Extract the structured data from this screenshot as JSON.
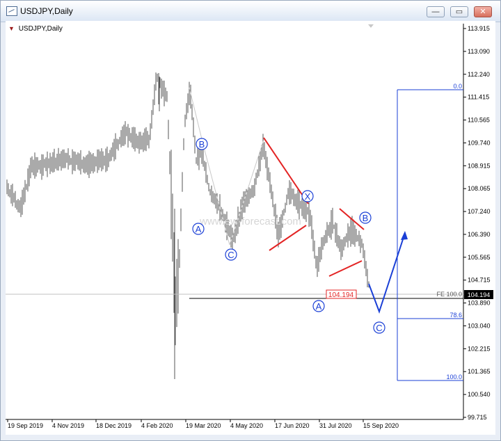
{
  "window": {
    "title": "USDJPY,Daily",
    "buttons": {
      "minimize": "—",
      "restore": "▭",
      "close": "✕"
    }
  },
  "chart": {
    "symbol_label": "USDJPY,Daily",
    "current_price": "104.194",
    "price_box_label": "104.194",
    "watermark": "www.ew-forecast.com",
    "fib_labels": [
      "0.0",
      "FE 100.0",
      "78.6",
      "100.0"
    ],
    "wave_labels": [
      "B",
      "A",
      "C",
      "X",
      "B",
      "A",
      "C"
    ],
    "colors": {
      "red": "#e32424",
      "blue": "#1a3fd6",
      "fib": "#1a3fd6",
      "candles": "#555555"
    }
  },
  "chart_data": {
    "type": "bar",
    "y_ticks": [
      "113.915",
      "113.090",
      "112.240",
      "111.415",
      "110.565",
      "109.740",
      "108.915",
      "108.065",
      "107.240",
      "106.390",
      "105.565",
      "104.715",
      "103.890",
      "103.040",
      "102.215",
      "101.365",
      "100.540",
      "99.715"
    ],
    "x_ticks": [
      "19 Sep 2019",
      "4 Nov 2019",
      "18 Dec 2019",
      "4 Feb 2020",
      "19 Mar 2020",
      "4 May 2020",
      "17 Jun 2020",
      "31 Jul 2020",
      "15 Sep 2020"
    ],
    "ylim": [
      99.6,
      114.2
    ],
    "current_price": 104.194
  }
}
